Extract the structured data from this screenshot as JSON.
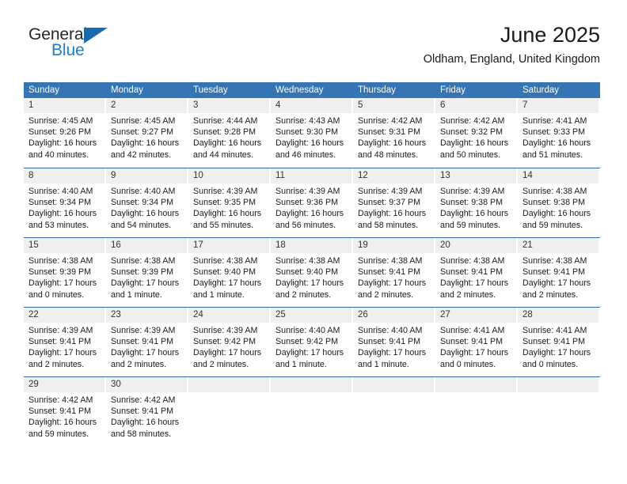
{
  "brand": {
    "name_part1": "General",
    "name_part2": "Blue"
  },
  "header": {
    "title": "June 2025",
    "subtitle": "Oldham, England, United Kingdom"
  },
  "colors": {
    "header_blue": "#3575b4",
    "row_divider": "#2f6ca8",
    "day_strip": "#efefef",
    "brand_blue": "#1b7fd4"
  },
  "weekdays": [
    "Sunday",
    "Monday",
    "Tuesday",
    "Wednesday",
    "Thursday",
    "Friday",
    "Saturday"
  ],
  "weeks": [
    [
      {
        "day": "1",
        "sunrise": "Sunrise: 4:45 AM",
        "sunset": "Sunset: 9:26 PM",
        "daylight_line1": "Daylight: 16 hours",
        "daylight_line2": "and 40 minutes."
      },
      {
        "day": "2",
        "sunrise": "Sunrise: 4:45 AM",
        "sunset": "Sunset: 9:27 PM",
        "daylight_line1": "Daylight: 16 hours",
        "daylight_line2": "and 42 minutes."
      },
      {
        "day": "3",
        "sunrise": "Sunrise: 4:44 AM",
        "sunset": "Sunset: 9:28 PM",
        "daylight_line1": "Daylight: 16 hours",
        "daylight_line2": "and 44 minutes."
      },
      {
        "day": "4",
        "sunrise": "Sunrise: 4:43 AM",
        "sunset": "Sunset: 9:30 PM",
        "daylight_line1": "Daylight: 16 hours",
        "daylight_line2": "and 46 minutes."
      },
      {
        "day": "5",
        "sunrise": "Sunrise: 4:42 AM",
        "sunset": "Sunset: 9:31 PM",
        "daylight_line1": "Daylight: 16 hours",
        "daylight_line2": "and 48 minutes."
      },
      {
        "day": "6",
        "sunrise": "Sunrise: 4:42 AM",
        "sunset": "Sunset: 9:32 PM",
        "daylight_line1": "Daylight: 16 hours",
        "daylight_line2": "and 50 minutes."
      },
      {
        "day": "7",
        "sunrise": "Sunrise: 4:41 AM",
        "sunset": "Sunset: 9:33 PM",
        "daylight_line1": "Daylight: 16 hours",
        "daylight_line2": "and 51 minutes."
      }
    ],
    [
      {
        "day": "8",
        "sunrise": "Sunrise: 4:40 AM",
        "sunset": "Sunset: 9:34 PM",
        "daylight_line1": "Daylight: 16 hours",
        "daylight_line2": "and 53 minutes."
      },
      {
        "day": "9",
        "sunrise": "Sunrise: 4:40 AM",
        "sunset": "Sunset: 9:34 PM",
        "daylight_line1": "Daylight: 16 hours",
        "daylight_line2": "and 54 minutes."
      },
      {
        "day": "10",
        "sunrise": "Sunrise: 4:39 AM",
        "sunset": "Sunset: 9:35 PM",
        "daylight_line1": "Daylight: 16 hours",
        "daylight_line2": "and 55 minutes."
      },
      {
        "day": "11",
        "sunrise": "Sunrise: 4:39 AM",
        "sunset": "Sunset: 9:36 PM",
        "daylight_line1": "Daylight: 16 hours",
        "daylight_line2": "and 56 minutes."
      },
      {
        "day": "12",
        "sunrise": "Sunrise: 4:39 AM",
        "sunset": "Sunset: 9:37 PM",
        "daylight_line1": "Daylight: 16 hours",
        "daylight_line2": "and 58 minutes."
      },
      {
        "day": "13",
        "sunrise": "Sunrise: 4:39 AM",
        "sunset": "Sunset: 9:38 PM",
        "daylight_line1": "Daylight: 16 hours",
        "daylight_line2": "and 59 minutes."
      },
      {
        "day": "14",
        "sunrise": "Sunrise: 4:38 AM",
        "sunset": "Sunset: 9:38 PM",
        "daylight_line1": "Daylight: 16 hours",
        "daylight_line2": "and 59 minutes."
      }
    ],
    [
      {
        "day": "15",
        "sunrise": "Sunrise: 4:38 AM",
        "sunset": "Sunset: 9:39 PM",
        "daylight_line1": "Daylight: 17 hours",
        "daylight_line2": "and 0 minutes."
      },
      {
        "day": "16",
        "sunrise": "Sunrise: 4:38 AM",
        "sunset": "Sunset: 9:39 PM",
        "daylight_line1": "Daylight: 17 hours",
        "daylight_line2": "and 1 minute."
      },
      {
        "day": "17",
        "sunrise": "Sunrise: 4:38 AM",
        "sunset": "Sunset: 9:40 PM",
        "daylight_line1": "Daylight: 17 hours",
        "daylight_line2": "and 1 minute."
      },
      {
        "day": "18",
        "sunrise": "Sunrise: 4:38 AM",
        "sunset": "Sunset: 9:40 PM",
        "daylight_line1": "Daylight: 17 hours",
        "daylight_line2": "and 2 minutes."
      },
      {
        "day": "19",
        "sunrise": "Sunrise: 4:38 AM",
        "sunset": "Sunset: 9:41 PM",
        "daylight_line1": "Daylight: 17 hours",
        "daylight_line2": "and 2 minutes."
      },
      {
        "day": "20",
        "sunrise": "Sunrise: 4:38 AM",
        "sunset": "Sunset: 9:41 PM",
        "daylight_line1": "Daylight: 17 hours",
        "daylight_line2": "and 2 minutes."
      },
      {
        "day": "21",
        "sunrise": "Sunrise: 4:38 AM",
        "sunset": "Sunset: 9:41 PM",
        "daylight_line1": "Daylight: 17 hours",
        "daylight_line2": "and 2 minutes."
      }
    ],
    [
      {
        "day": "22",
        "sunrise": "Sunrise: 4:39 AM",
        "sunset": "Sunset: 9:41 PM",
        "daylight_line1": "Daylight: 17 hours",
        "daylight_line2": "and 2 minutes."
      },
      {
        "day": "23",
        "sunrise": "Sunrise: 4:39 AM",
        "sunset": "Sunset: 9:41 PM",
        "daylight_line1": "Daylight: 17 hours",
        "daylight_line2": "and 2 minutes."
      },
      {
        "day": "24",
        "sunrise": "Sunrise: 4:39 AM",
        "sunset": "Sunset: 9:42 PM",
        "daylight_line1": "Daylight: 17 hours",
        "daylight_line2": "and 2 minutes."
      },
      {
        "day": "25",
        "sunrise": "Sunrise: 4:40 AM",
        "sunset": "Sunset: 9:42 PM",
        "daylight_line1": "Daylight: 17 hours",
        "daylight_line2": "and 1 minute."
      },
      {
        "day": "26",
        "sunrise": "Sunrise: 4:40 AM",
        "sunset": "Sunset: 9:41 PM",
        "daylight_line1": "Daylight: 17 hours",
        "daylight_line2": "and 1 minute."
      },
      {
        "day": "27",
        "sunrise": "Sunrise: 4:41 AM",
        "sunset": "Sunset: 9:41 PM",
        "daylight_line1": "Daylight: 17 hours",
        "daylight_line2": "and 0 minutes."
      },
      {
        "day": "28",
        "sunrise": "Sunrise: 4:41 AM",
        "sunset": "Sunset: 9:41 PM",
        "daylight_line1": "Daylight: 17 hours",
        "daylight_line2": "and 0 minutes."
      }
    ],
    [
      {
        "day": "29",
        "sunrise": "Sunrise: 4:42 AM",
        "sunset": "Sunset: 9:41 PM",
        "daylight_line1": "Daylight: 16 hours",
        "daylight_line2": "and 59 minutes."
      },
      {
        "day": "30",
        "sunrise": "Sunrise: 4:42 AM",
        "sunset": "Sunset: 9:41 PM",
        "daylight_line1": "Daylight: 16 hours",
        "daylight_line2": "and 58 minutes."
      },
      {
        "day": "",
        "sunrise": "",
        "sunset": "",
        "daylight_line1": "",
        "daylight_line2": ""
      },
      {
        "day": "",
        "sunrise": "",
        "sunset": "",
        "daylight_line1": "",
        "daylight_line2": ""
      },
      {
        "day": "",
        "sunrise": "",
        "sunset": "",
        "daylight_line1": "",
        "daylight_line2": ""
      },
      {
        "day": "",
        "sunrise": "",
        "sunset": "",
        "daylight_line1": "",
        "daylight_line2": ""
      },
      {
        "day": "",
        "sunrise": "",
        "sunset": "",
        "daylight_line1": "",
        "daylight_line2": ""
      }
    ]
  ]
}
